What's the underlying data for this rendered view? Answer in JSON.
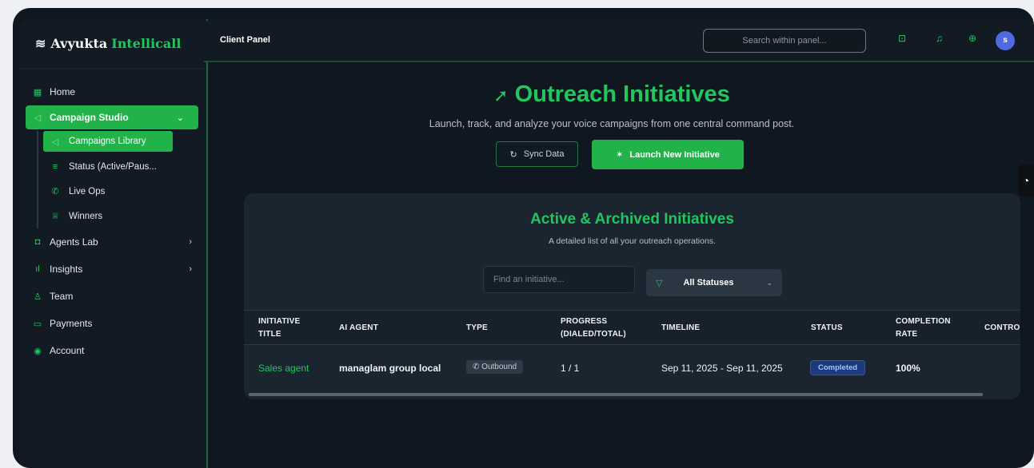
{
  "brand": {
    "name_1": "Avyukta",
    "name_2": "Intellicall"
  },
  "sidebar": {
    "items": [
      {
        "label": "Home"
      },
      {
        "label": "Campaign Studio"
      },
      {
        "label": "Agents Lab"
      },
      {
        "label": "Insights"
      },
      {
        "label": "Team"
      },
      {
        "label": "Payments"
      },
      {
        "label": "Account"
      }
    ],
    "sub_items": [
      {
        "label": "Campaigns Library"
      },
      {
        "label": "Status (Active/Paus..."
      },
      {
        "label": "Live Ops"
      },
      {
        "label": "Winners"
      }
    ]
  },
  "header": {
    "title": "Client Panel",
    "search_placeholder": "Search within panel...",
    "avatar_initial": "s"
  },
  "hero": {
    "title": "Outreach Initiatives",
    "subtitle": "Launch, track, and analyze your voice campaigns from one central command post.",
    "sync_label": "Sync Data",
    "launch_label": "Launch New Initiative"
  },
  "card": {
    "title": "Active & Archived Initiatives",
    "subtitle": "A detailed list of all your outreach operations.",
    "search_placeholder": "Find an initiative...",
    "status_filter": "All Statuses"
  },
  "table": {
    "columns": [
      {
        "line1": "INITIATIVE",
        "line2": "TITLE"
      },
      {
        "line1": "AI AGENT",
        "line2": ""
      },
      {
        "line1": "TYPE",
        "line2": ""
      },
      {
        "line1": "PROGRESS",
        "line2": "(DIALED/TOTAL)"
      },
      {
        "line1": "TIMELINE",
        "line2": ""
      },
      {
        "line1": "STATUS",
        "line2": ""
      },
      {
        "line1": "COMPLETION",
        "line2": "RATE"
      },
      {
        "line1": "CONTRO",
        "line2": ""
      }
    ],
    "rows": [
      {
        "title": "Sales agent",
        "agent": "managlam group local",
        "type": "Outbound",
        "progress": "1 / 1",
        "timeline": "Sep 11, 2025 - Sep 11, 2025",
        "status": "Completed",
        "completion": "100%"
      }
    ]
  },
  "colors": {
    "accent": "#22c55e",
    "background": "#0f1720",
    "status_completed": "#1d3a7a"
  }
}
